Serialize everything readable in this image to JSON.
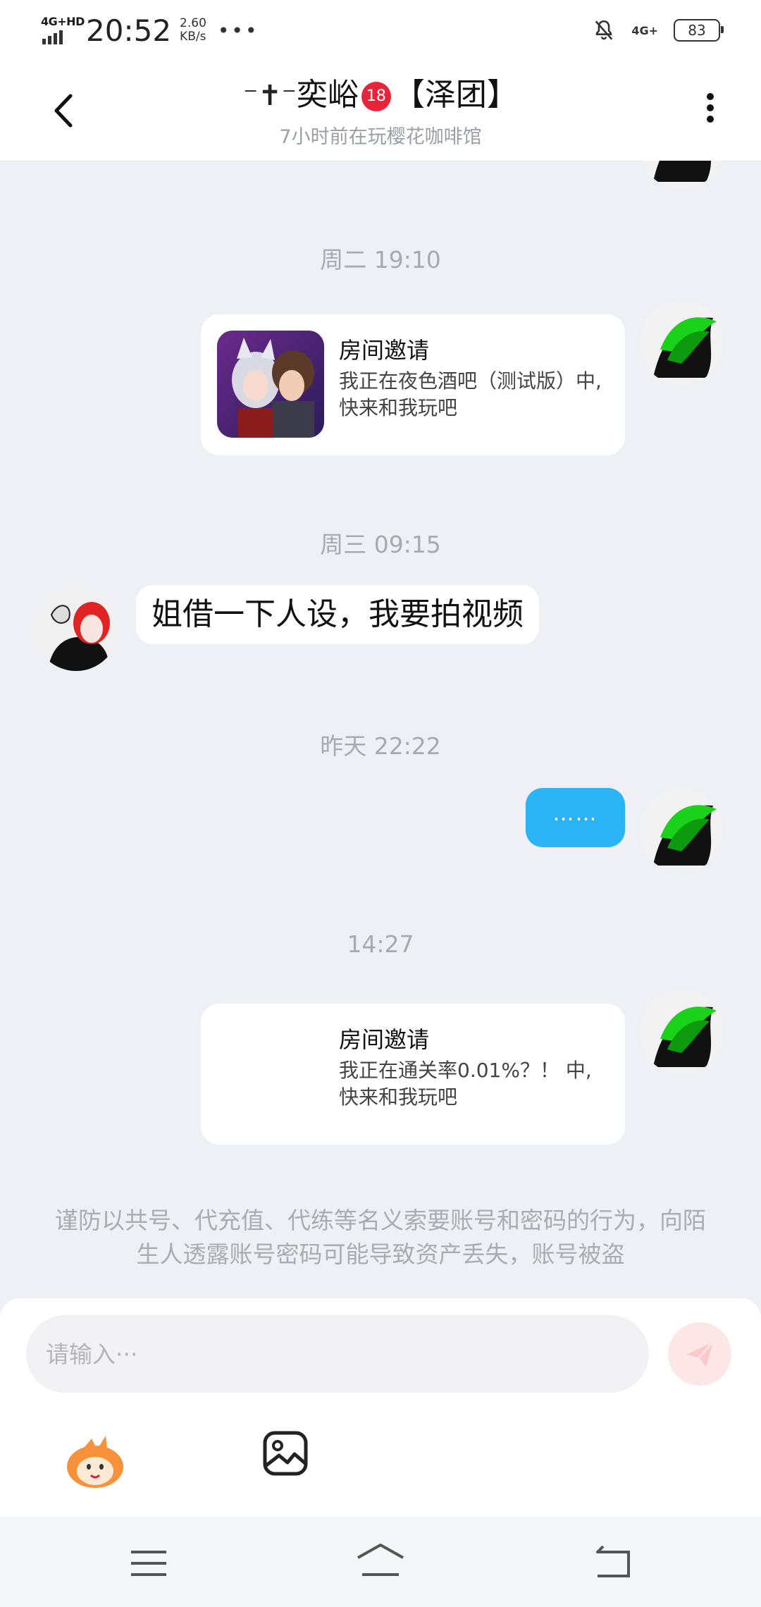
{
  "status_bar": {
    "network": "4G+HD",
    "time": "20:52",
    "speed_value": "2.60",
    "speed_unit": "KB/s",
    "more": "•••",
    "net_right": "4G+",
    "battery": "83"
  },
  "header": {
    "title_prefix": "奕峪",
    "title_badge": "18",
    "title_suffix": "【泽团】",
    "subtitle": "7小时前在玩樱花咖啡馆"
  },
  "messages": {
    "ts1": "周二 19:10",
    "card1_title": "房间邀请",
    "card1_desc": "我正在夜色酒吧（测试版）中, 快来和我玩吧",
    "ts2": "周三 09:15",
    "text_left": "姐借一下人设，我要拍视频",
    "ts3": "昨天 22:22",
    "text_right": "……",
    "ts4": "14:27",
    "card2_title": "房间邀请",
    "card2_desc": "我正在通关率0.01%？！ 中,快来和我玩吧"
  },
  "notice": "谨防以共号、代充值、代练等名义索要账号和密码的行为，向陌生人透露账号密码可能导致资产丢失，账号被盗",
  "input": {
    "placeholder": "请输入···"
  },
  "colors": {
    "accent_blue": "#2ab4f5",
    "send_disabled": "#fde6e6",
    "badge_red": "#e8243a"
  }
}
